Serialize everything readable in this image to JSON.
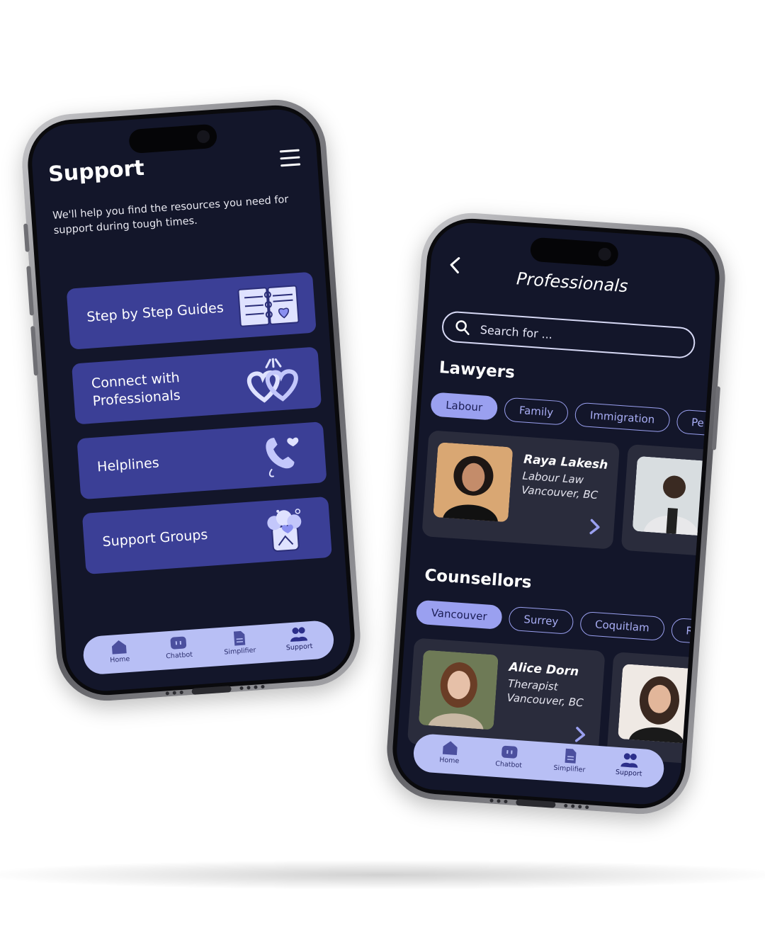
{
  "support_screen": {
    "title": "Support",
    "subtitle": "We'll help you find the resources you need for support during tough times.",
    "menu": [
      {
        "label": "Step by Step Guides",
        "icon": "guide-book-icon"
      },
      {
        "label": "Connect with Professionals",
        "icon": "linked-hearts-icon"
      },
      {
        "label": "Helplines",
        "icon": "phone-heart-icon"
      },
      {
        "label": "Support Groups",
        "icon": "group-hearts-jar-icon"
      }
    ]
  },
  "professionals_screen": {
    "title": "Professionals",
    "search_placeholder": "Search for ...",
    "lawyers": {
      "title": "Lawyers",
      "filters": [
        "Labour",
        "Family",
        "Immigration",
        "Pe"
      ],
      "active_filter": "Labour",
      "cards": [
        {
          "name": "Raya Lakesh",
          "role": "Labour Law",
          "location": "Vancouver, BC"
        }
      ]
    },
    "counsellors": {
      "title": "Counsellors",
      "filters": [
        "Vancouver",
        "Surrey",
        "Coquitlam",
        "R"
      ],
      "active_filter": "Vancouver",
      "cards": [
        {
          "name": "Alice Dorn",
          "role": "Therapist",
          "location": "Vancouver, BC"
        }
      ]
    }
  },
  "tabbar": [
    {
      "label": "Home",
      "icon": "home-icon"
    },
    {
      "label": "Chatbot",
      "icon": "chatbot-icon"
    },
    {
      "label": "Simplifier",
      "icon": "document-icon"
    },
    {
      "label": "Support",
      "icon": "people-icon",
      "active": true
    }
  ],
  "colors": {
    "screen_bg": "#13162a",
    "card_bg": "#3b3f96",
    "accent": "#9aa0f0",
    "tabbar_bg": "#b8bff5"
  }
}
